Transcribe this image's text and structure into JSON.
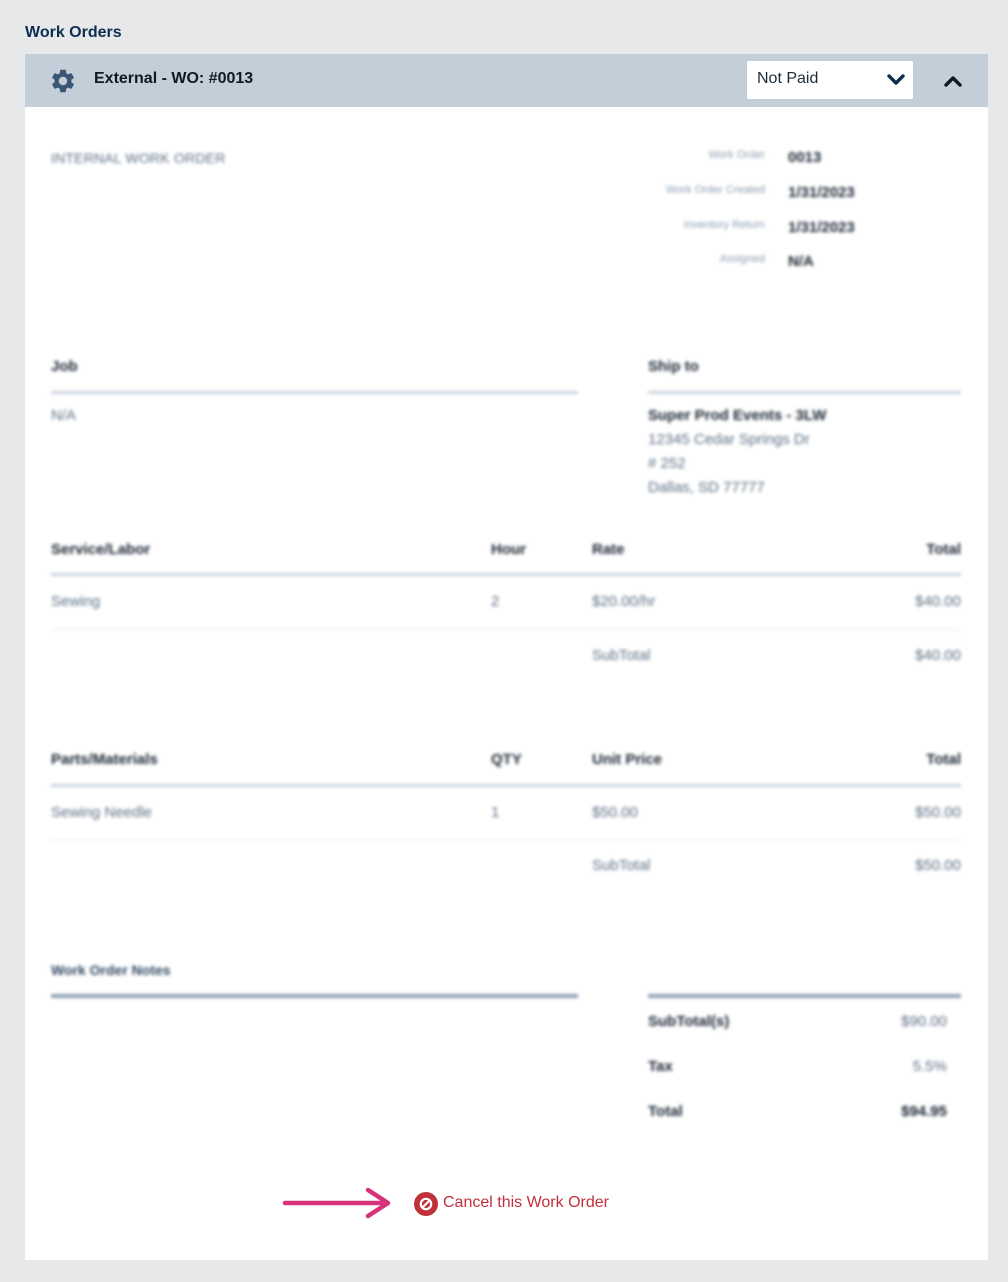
{
  "section_title": "Work Orders",
  "header": {
    "title": "External - WO: #0013",
    "status_select_value": "Not Paid"
  },
  "document": {
    "title": "INTERNAL WORK ORDER",
    "meta": [
      {
        "label": "Work Order",
        "value": "0013"
      },
      {
        "label": "Work Order Created",
        "value": "1/31/2023"
      },
      {
        "label": "Inventory Return",
        "value": "1/31/2023"
      },
      {
        "label": "Assigned",
        "value": "N/A"
      }
    ],
    "job": {
      "label": "Job",
      "value": "N/A"
    },
    "ship_to": {
      "label": "Ship to",
      "name": "Super Prod Events - 3LW",
      "line1": "12345 Cedar Springs Dr",
      "line2": "# 252",
      "line3": "Dallas, SD 77777"
    },
    "services": {
      "headers": [
        "Service/Labor",
        "Hour",
        "Rate",
        "Total"
      ],
      "rows": [
        {
          "name": "Sewing",
          "qty": "2",
          "rate": "$20.00/hr",
          "total": "$40.00"
        }
      ],
      "subtotal_label": "SubTotal",
      "subtotal_value": "$40.00"
    },
    "parts": {
      "headers": [
        "Parts/Materials",
        "QTY",
        "Unit Price",
        "Total"
      ],
      "rows": [
        {
          "name": "Sewing Needle",
          "qty": "1",
          "rate": "$50.00",
          "total": "$50.00"
        }
      ],
      "subtotal_label": "SubTotal",
      "subtotal_value": "$50.00"
    },
    "notes_label": "Work Order Notes",
    "summary": [
      {
        "label": "SubTotal(s)",
        "value": "$90.00"
      },
      {
        "label": "Tax",
        "value": "5.5%"
      },
      {
        "label": "Total",
        "value": "$94.95"
      }
    ]
  },
  "cancel_label": "Cancel this Work Order",
  "colors": {
    "header_bg": "#c3ced8",
    "accent_red": "#c0313a",
    "arrow_pink": "#d6337a",
    "gear": "#3a5673"
  }
}
